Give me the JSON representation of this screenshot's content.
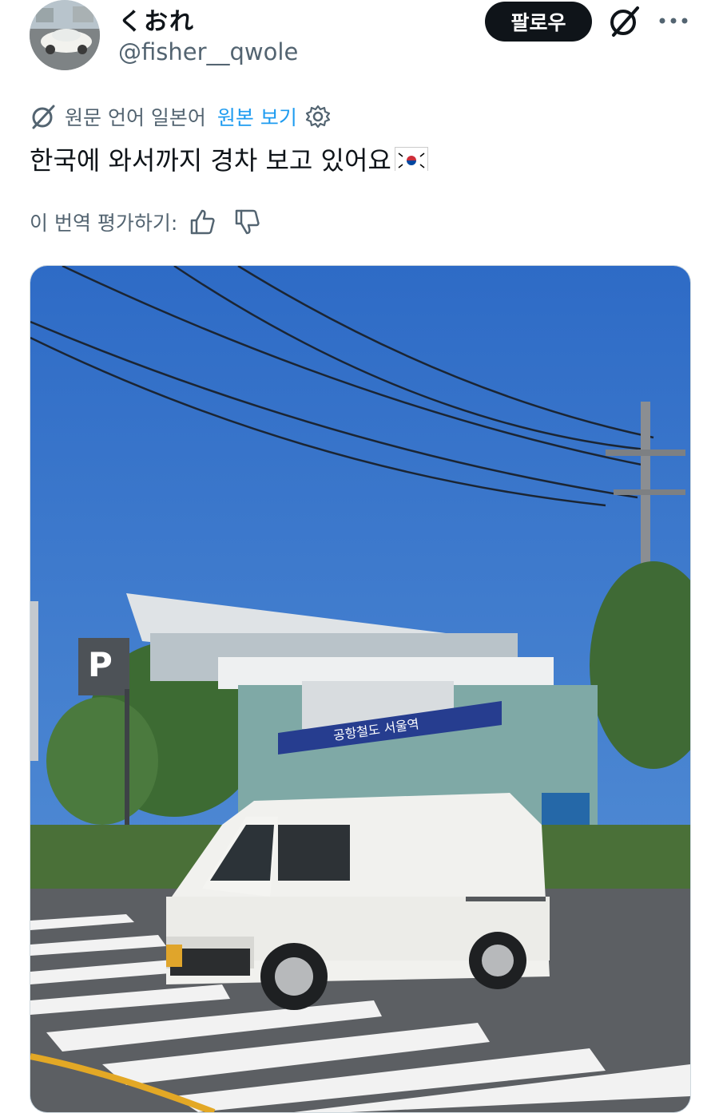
{
  "user": {
    "display_name": "くおれ",
    "handle": "@fisher__qwole",
    "follow_label": "팔로우"
  },
  "translation": {
    "source_language": "원문 언어 일본어",
    "view_original": "원본 보기"
  },
  "tweet": {
    "text": "한국에 와서까지 경차 보고 있어요"
  },
  "rating": {
    "label": "이 번역 평가하기:"
  },
  "media": {
    "station_sign": "공항철도 서울역",
    "parking_letter": "P"
  },
  "icons": {
    "grok": "grok-icon",
    "more": "more-dots-icon",
    "translate": "translate-icon",
    "settings": "gear-icon",
    "thumbs_up": "thumbs-up-icon",
    "thumbs_down": "thumbs-down-icon",
    "flag": "korea-flag-icon"
  },
  "colors": {
    "accent": "#1d9bf0",
    "follow_bg": "#0f1419",
    "muted": "#536471",
    "sky": "#2f6fc7"
  }
}
